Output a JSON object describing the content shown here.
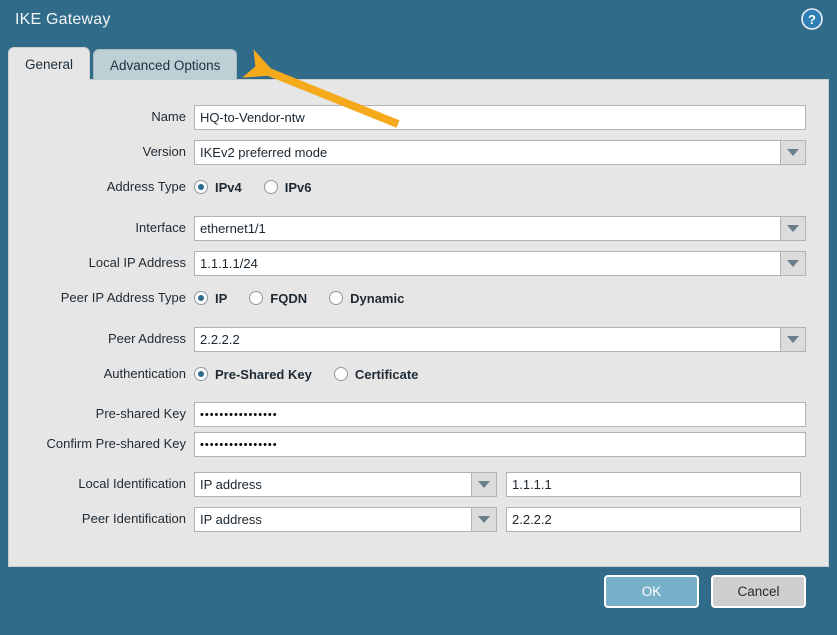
{
  "window": {
    "title": "IKE Gateway",
    "help_icon": "help-circle-icon",
    "titlebar_color": "#316b8a",
    "panel_color": "#e6e6e6"
  },
  "tabs": [
    {
      "label": "General",
      "active": true
    },
    {
      "label": "Advanced Options",
      "active": false
    }
  ],
  "form": {
    "name": {
      "label": "Name",
      "value": "HQ-to-Vendor-ntw"
    },
    "version": {
      "label": "Version",
      "value": "IKEv2 preferred mode"
    },
    "address_type": {
      "label": "Address Type",
      "options": [
        "IPv4",
        "IPv6"
      ],
      "selected": "IPv4"
    },
    "interface": {
      "label": "Interface",
      "value": "ethernet1/1"
    },
    "local_ip_address": {
      "label": "Local IP Address",
      "value": "1.1.1.1/24"
    },
    "peer_ip_address_type": {
      "label": "Peer IP Address Type",
      "options": [
        "IP",
        "FQDN",
        "Dynamic"
      ],
      "selected": "IP"
    },
    "peer_address": {
      "label": "Peer Address",
      "value": "2.2.2.2"
    },
    "authentication": {
      "label": "Authentication",
      "options": [
        "Pre-Shared Key",
        "Certificate"
      ],
      "selected": "Pre-Shared Key"
    },
    "pre_shared_key": {
      "label": "Pre-shared Key",
      "value": "••••••••••••••••"
    },
    "confirm_pre_shared_key": {
      "label": "Confirm Pre-shared Key",
      "value": "••••••••••••••••"
    },
    "local_identification": {
      "label": "Local Identification",
      "type_value": "IP address",
      "value": "1.1.1.1"
    },
    "peer_identification": {
      "label": "Peer Identification",
      "type_value": "IP address",
      "value": "2.2.2.2"
    }
  },
  "footer": {
    "ok_label": "OK",
    "cancel_label": "Cancel",
    "ok_color": "#79b0c9",
    "cancel_color": "#cfcfcf"
  },
  "annotation": {
    "type": "arrow",
    "color": "#f5aa1c",
    "points_to": "Advanced Options"
  }
}
